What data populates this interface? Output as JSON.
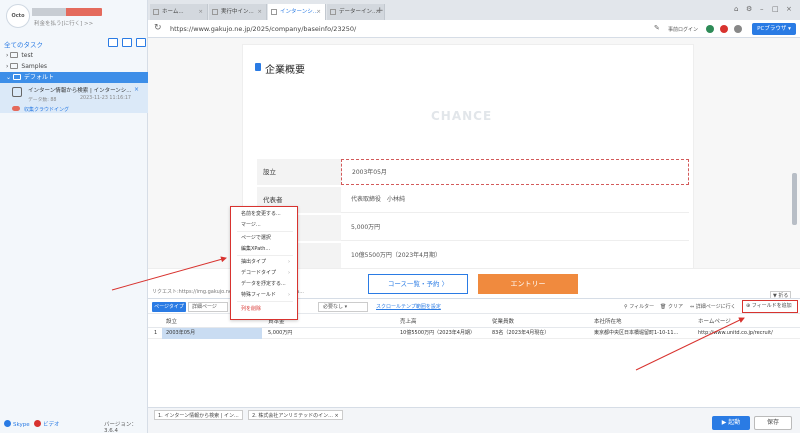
{
  "sidebar": {
    "logo_text": "Octo",
    "user_sub": "利金を払う[に行く] >>",
    "all_tasks": "全てのタスク",
    "tree": [
      {
        "label": "test"
      },
      {
        "label": "Samples"
      },
      {
        "label": "デフォルト"
      }
    ],
    "task": {
      "title": "インターン情報から検索 | インターンシ...",
      "meta": "データ数: 88",
      "time": "2023-11-23 11:16:17",
      "cloud": "収集クラウドイング",
      "close": "×"
    },
    "skype": "Skype",
    "video": "ビデオ",
    "version": "バージョン：3.6.4"
  },
  "browser": {
    "tabs": [
      {
        "label": "ホーム..."
      },
      {
        "label": "実行中イン..."
      },
      {
        "label": "インターンシ..."
      },
      {
        "label": "データーイン..."
      }
    ],
    "new_tab": "+",
    "url": "https://www.gakujo.ne.jp/2025/company/baseinfo/23250/",
    "login": "事前ログイン",
    "pc_browser": "PCブラウザ",
    "refresh": "↻",
    "edit": "✎"
  },
  "webpage": {
    "title": "企業概要",
    "watermark": "CHANCE",
    "rows": [
      {
        "label": "設立",
        "value": "2003年05月"
      },
      {
        "label": "代表者",
        "value": "代表取締役　小林純"
      },
      {
        "label": "",
        "value": "5,000万円"
      },
      {
        "label": "",
        "value": "10億5500万円（2023年4月期）"
      }
    ],
    "course_btn": "コース一覧・予約 〉",
    "entry_btn": "エントリー",
    "fold": "▼ 折る"
  },
  "request_bar": "リクエスト:https://img.gakujo.ne.jp/...ge/publication/img/ba...",
  "panel": {
    "page_type": "ページタイプ",
    "detail_page": "詳細ページ",
    "select": "必要なし",
    "scroll": "スクロールテンプ範囲を設定",
    "filter": "フィルター",
    "clear": "クリア",
    "detail_link": "詳細ページに行く",
    "add_field": "⊕ フィールドを追加"
  },
  "grid": {
    "columns": [
      "設立",
      "資本金",
      "売上高",
      "従業員数",
      "本社所在地",
      "ホームページ"
    ],
    "rows": [
      [
        "2003年05月",
        "5,000万円",
        "10億5500万円（2023年4月期）",
        "83名（2023年4月現在）",
        "東京都中央区日本橋堀留町1-10-11...",
        "http://www.unitd.co.jp/recruit/"
      ]
    ]
  },
  "context_menu": [
    {
      "label": "名前を変更する..."
    },
    {
      "label": "マージ..."
    },
    {
      "label": "ページで選択"
    },
    {
      "label": "編集XPath..."
    },
    {
      "label": "抽出タイプ"
    },
    {
      "label": "デコードタイプ"
    },
    {
      "label": "データを抒定する..."
    },
    {
      "label": "特殊フィールド"
    },
    {
      "label": "列を削除"
    }
  ],
  "bottom": {
    "tabs": [
      {
        "label": "1. インターン情報から検索 | イン..."
      },
      {
        "label": "2. 株式会社アンリミテッドのイン..."
      }
    ],
    "start": "▶ 起動",
    "save": "保存"
  },
  "colors": {
    "accent": "#2a7be4",
    "highlight": "#d8332f",
    "entry": "#f08a3e"
  }
}
